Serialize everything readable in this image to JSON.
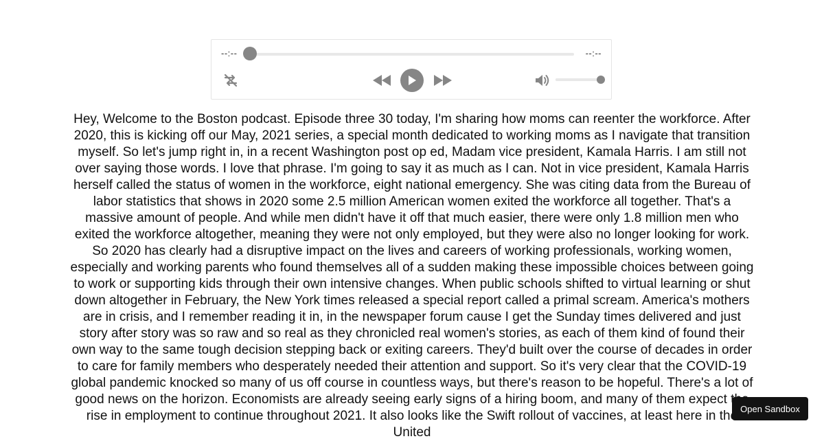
{
  "player": {
    "current_time": "--:--",
    "duration": "--:--",
    "progress_fraction": 0,
    "volume_fraction": 1,
    "icons": {
      "loop": "loop-off-icon",
      "rewind": "rewind-icon",
      "play": "play-icon",
      "fast_forward": "fast-forward-icon",
      "volume": "volume-icon"
    },
    "colors": {
      "control": "#868686",
      "track": "#e8e8e8"
    }
  },
  "transcript": {
    "text": "Hey, Welcome to the Boston podcast. Episode three 30 today, I'm sharing how moms can reenter the workforce. After 2020, this is kicking off our May, 2021 series, a special month dedicated to working moms as I navigate that transition myself. So let's jump right in, in a recent Washington post op ed, Madam vice president, Kamala Harris. I am still not over saying those words. I love that phrase. I'm going to say it as much as I can. Not in vice president, Kamala Harris herself called the status of women in the workforce, eight national emergency. She was citing data from the Bureau of labor statistics that shows in 2020 some 2.5 million American women exited the workforce all together. That's a massive amount of people. And while men didn't have it off that much easier, there were only 1.8 million men who exited the workforce altogether, meaning they were not only employed, but they were also no longer looking for work. So 2020 has clearly had a disruptive impact on the lives and careers of working professionals, working women, especially and working parents who found themselves all of a sudden making these impossible choices between going to work or supporting kids through their own intensive changes. When public schools shifted to virtual learning or shut down altogether in February, the New York times released a special report called a primal scream. America's mothers are in crisis, and I remember reading it in, in the newspaper forum cause I get the Sunday times delivered and just story after story was so raw and so real as they chronicled real women's stories, as each of them kind of found their own way to the same tough decision stepping back or exiting careers. They'd built over the course of decades in order to care for family members who desperately needed their attention and support. So it's very clear that the COVID-19 global pandemic knocked so many of us off course in countless ways, but there's reason to be hopeful. There's a lot of good news on the horizon. Economists are already seeing early signs of a hiring boom, and many of them expect the rise in employment to continue throughout 2021. It also looks like the Swift rollout of vaccines, at least here in the United"
  },
  "sandbox_button": {
    "label": "Open Sandbox"
  }
}
